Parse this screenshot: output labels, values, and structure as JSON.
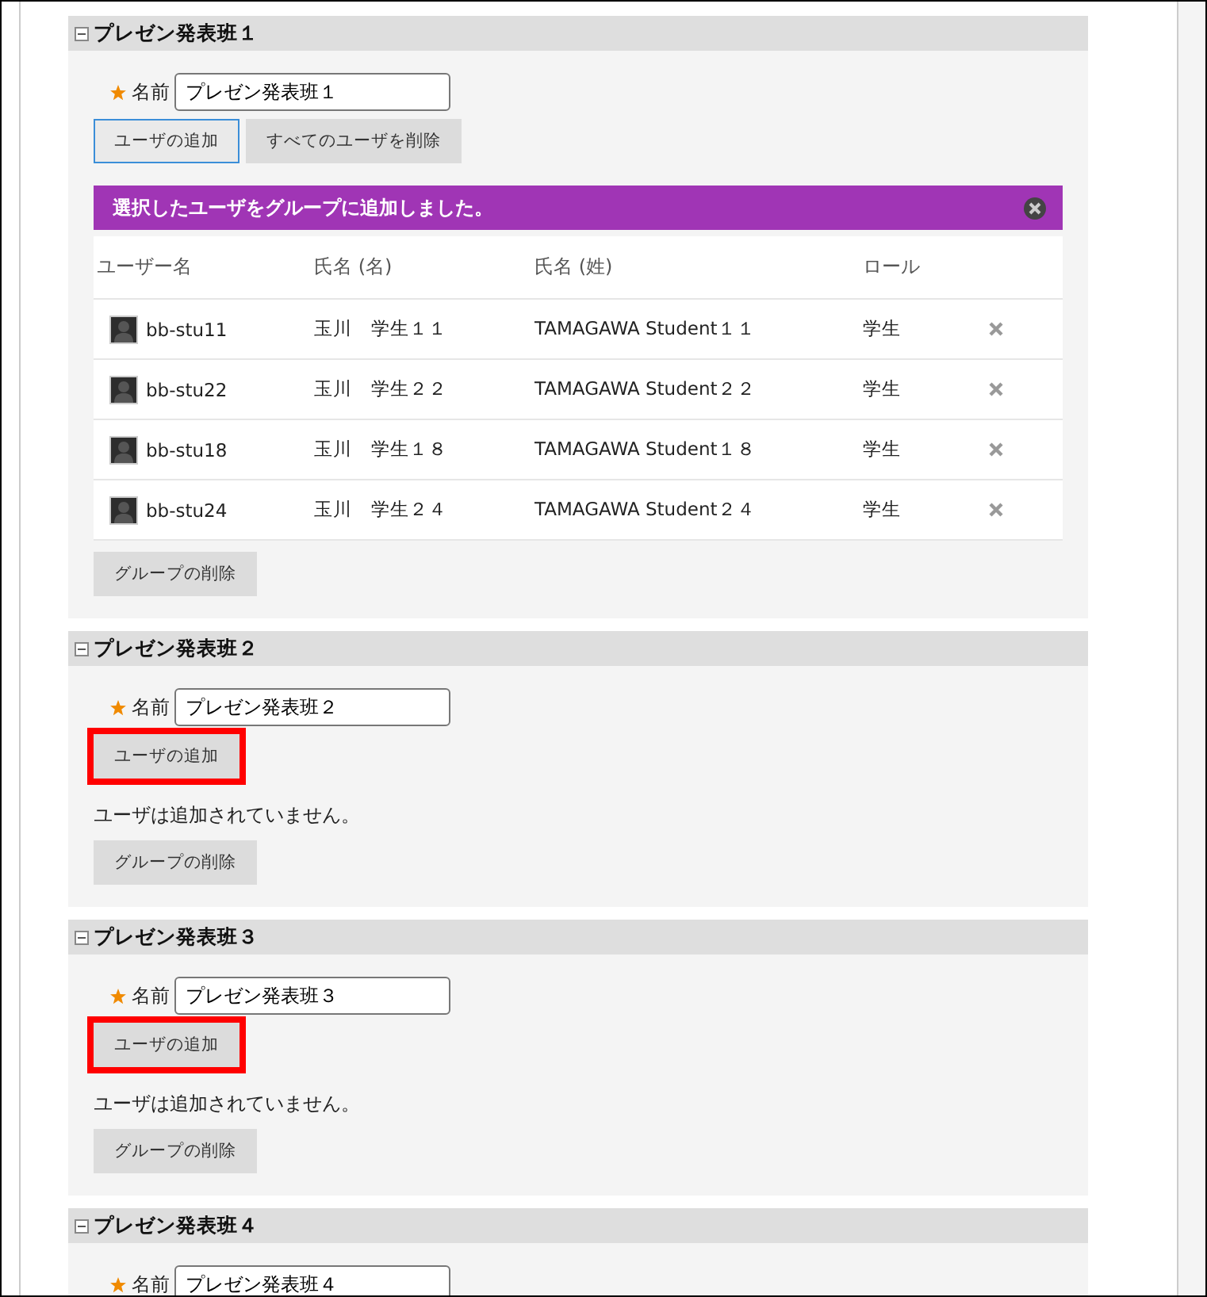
{
  "groups": [
    {
      "title": "プレゼン発表班１",
      "expanded": true,
      "name_label": "名前",
      "name_value": "プレゼン発表班１",
      "add_button": {
        "label": "ユーザの追加",
        "focused": true,
        "highlighted": false
      },
      "remove_all_button": "すべてのユーザを削除",
      "message": "選択したユーザをグループに追加しました。",
      "columns": [
        "ユーザー名",
        "氏名 (名)",
        "氏名 (姓)",
        "ロール"
      ],
      "members": [
        {
          "username": "bb-stu11",
          "first_name": "玉川　学生１１",
          "last_name": "TAMAGAWA Student１１",
          "role": "学生"
        },
        {
          "username": "bb-stu22",
          "first_name": "玉川　学生２２",
          "last_name": "TAMAGAWA Student２２",
          "role": "学生"
        },
        {
          "username": "bb-stu18",
          "first_name": "玉川　学生１８",
          "last_name": "TAMAGAWA Student１８",
          "role": "学生"
        },
        {
          "username": "bb-stu24",
          "first_name": "玉川　学生２４",
          "last_name": "TAMAGAWA Student２４",
          "role": "学生"
        }
      ],
      "delete_button": "グループの削除"
    },
    {
      "title": "プレゼン発表班２",
      "expanded": true,
      "name_label": "名前",
      "name_value": "プレゼン発表班２",
      "add_button": {
        "label": "ユーザの追加",
        "focused": false,
        "highlighted": true
      },
      "empty_text": "ユーザは追加されていません。",
      "delete_button": "グループの削除"
    },
    {
      "title": "プレゼン発表班３",
      "expanded": true,
      "name_label": "名前",
      "name_value": "プレゼン発表班３",
      "add_button": {
        "label": "ユーザの追加",
        "focused": false,
        "highlighted": true
      },
      "empty_text": "ユーザは追加されていません。",
      "delete_button": "グループの削除"
    },
    {
      "title": "プレゼン発表班４",
      "expanded": true,
      "name_label": "名前",
      "name_value": "プレゼン発表班４"
    }
  ]
}
